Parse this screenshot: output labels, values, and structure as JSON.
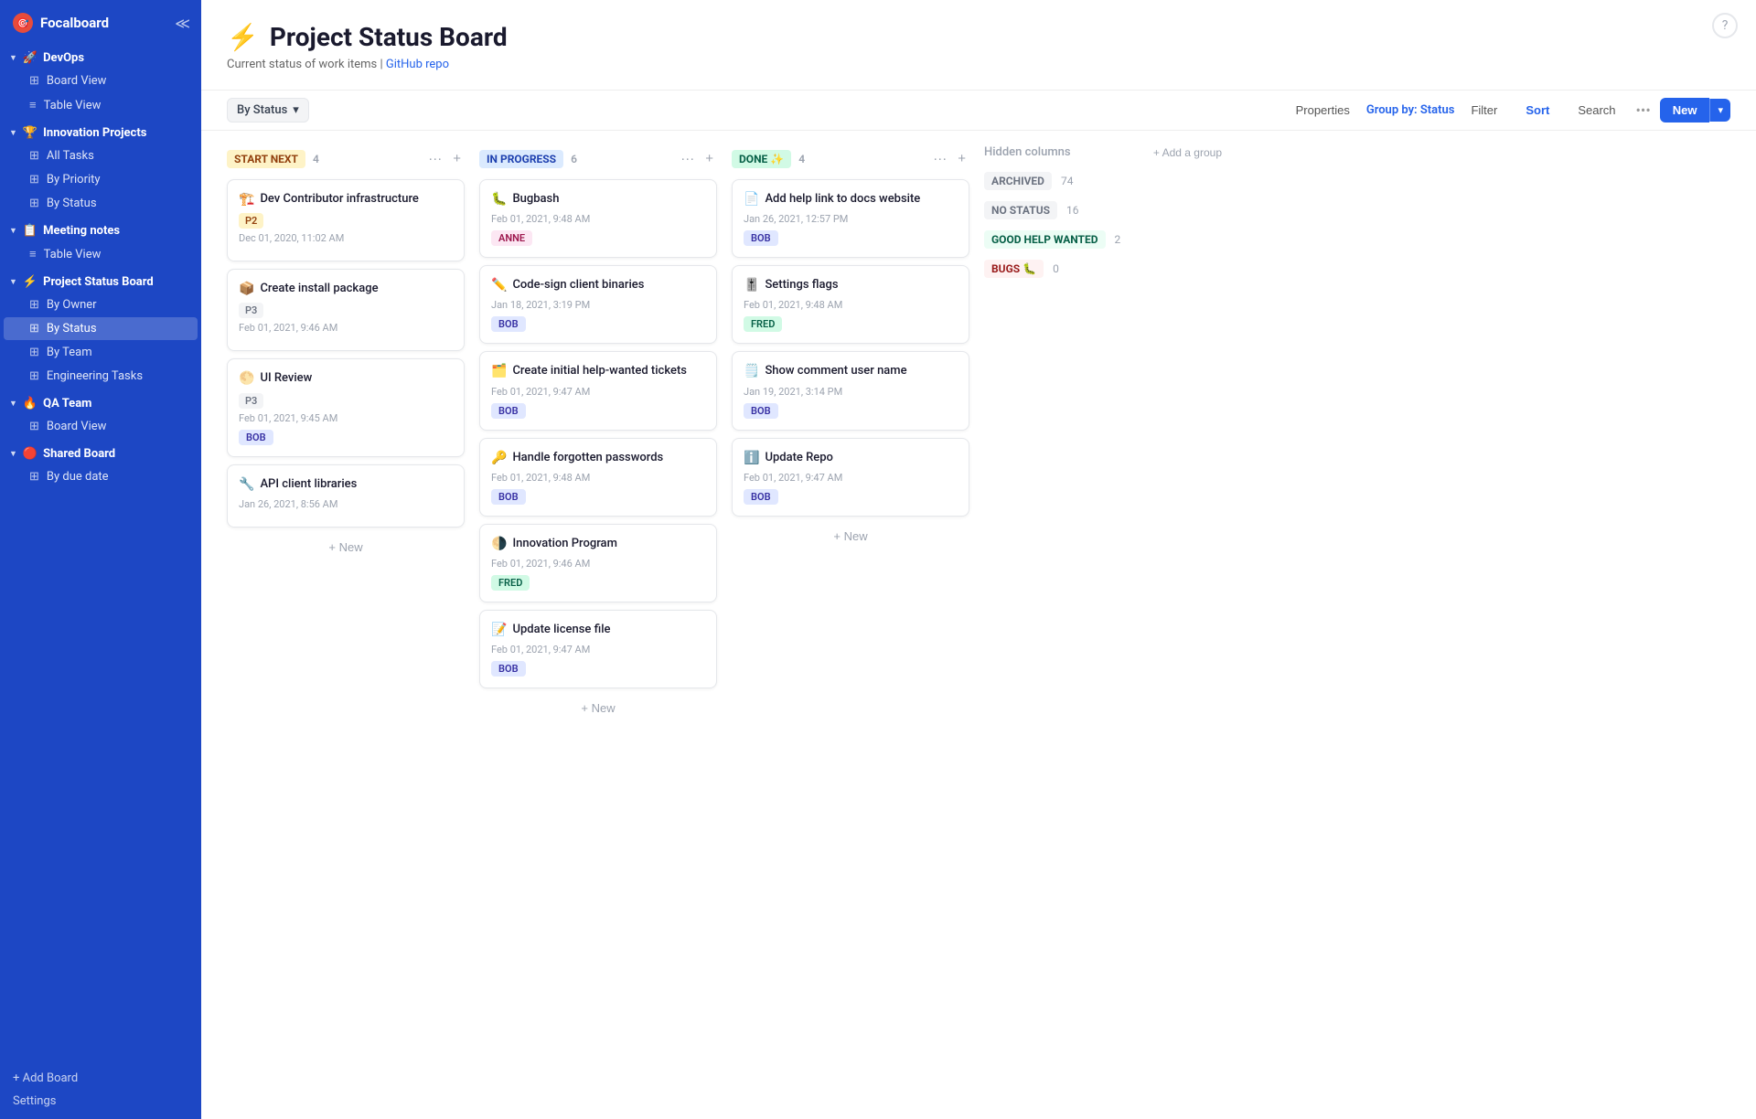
{
  "app": {
    "name": "Focalboard",
    "logo_icon": "🎯"
  },
  "sidebar": {
    "groups": [
      {
        "id": "devops",
        "emoji": "🚀",
        "label": "DevOps",
        "items": [
          {
            "id": "board-view-devops",
            "icon": "⊞",
            "label": "Board View"
          },
          {
            "id": "table-view-devops",
            "icon": "≡",
            "label": "Table View"
          }
        ]
      },
      {
        "id": "innovation",
        "emoji": "🏆",
        "label": "Innovation Projects",
        "items": [
          {
            "id": "all-tasks",
            "icon": "⊞",
            "label": "All Tasks"
          },
          {
            "id": "by-priority",
            "icon": "⊞",
            "label": "By Priority"
          },
          {
            "id": "by-status-innovation",
            "icon": "⊞",
            "label": "By Status"
          }
        ]
      },
      {
        "id": "meeting",
        "emoji": "📋",
        "label": "Meeting notes",
        "items": [
          {
            "id": "table-view-meeting",
            "icon": "≡",
            "label": "Table View"
          }
        ]
      },
      {
        "id": "project-status",
        "emoji": "⚡",
        "label": "Project Status Board",
        "items": [
          {
            "id": "by-owner",
            "icon": "⊞",
            "label": "By Owner"
          },
          {
            "id": "by-status-project",
            "icon": "⊞",
            "label": "By Status",
            "active": true
          },
          {
            "id": "by-team",
            "icon": "⊞",
            "label": "By Team"
          },
          {
            "id": "engineering-tasks",
            "icon": "⊞",
            "label": "Engineering Tasks"
          }
        ]
      },
      {
        "id": "qa-team",
        "emoji": "🔥",
        "label": "QA Team",
        "items": [
          {
            "id": "board-view-qa",
            "icon": "⊞",
            "label": "Board View"
          }
        ]
      },
      {
        "id": "shared-board",
        "emoji": "🔴",
        "label": "Shared Board",
        "items": [
          {
            "id": "by-due-date",
            "icon": "⊞",
            "label": "By due date"
          }
        ]
      }
    ],
    "add_board_label": "+ Add Board",
    "settings_label": "Settings"
  },
  "page": {
    "emoji": "⚡",
    "title": "Project Status Board",
    "subtitle": "Current status of work items | ",
    "subtitle_link": "GitHub repo",
    "view_selector_label": "By Status"
  },
  "toolbar": {
    "properties_label": "Properties",
    "group_by_label": "Group by:",
    "group_by_value": "Status",
    "filter_label": "Filter",
    "sort_label": "Sort",
    "search_label": "Search",
    "dots_label": "•••",
    "new_label": "New"
  },
  "columns": [
    {
      "id": "start-next",
      "label": "START NEXT",
      "label_class": "label-start",
      "count": 4,
      "cards": [
        {
          "id": "c1",
          "emoji": "🏗️",
          "title": "Dev Contributor infrastructure",
          "priority": "P2",
          "priority_class": "priority-p2",
          "date": "Dec 01, 2020, 11:02 AM",
          "assignee": null
        },
        {
          "id": "c2",
          "emoji": "📦",
          "title": "Create install package",
          "priority": "P3",
          "priority_class": "priority-p3",
          "date": "Feb 01, 2021, 9:46 AM",
          "assignee": null
        },
        {
          "id": "c3",
          "emoji": "🌕",
          "title": "UI Review",
          "priority": "P3",
          "priority_class": "priority-p3",
          "date": "Feb 01, 2021, 9:45 AM",
          "assignee": "BOB",
          "assignee_class": "assignee-bob"
        },
        {
          "id": "c4",
          "emoji": "🔧",
          "title": "API client libraries",
          "priority": null,
          "date": "Jan 26, 2021, 8:56 AM",
          "assignee": null
        }
      ],
      "add_new_label": "+ New"
    },
    {
      "id": "in-progress",
      "label": "IN PROGRESS",
      "label_class": "label-inprogress",
      "count": 6,
      "cards": [
        {
          "id": "c5",
          "emoji": "🐛",
          "title": "Bugbash",
          "priority": null,
          "date": "Feb 01, 2021, 9:48 AM",
          "assignee": "ANNE",
          "assignee_class": "assignee-anne"
        },
        {
          "id": "c6",
          "emoji": "✏️",
          "title": "Code-sign client binaries",
          "priority": null,
          "date": "Jan 18, 2021, 3:19 PM",
          "assignee": "BOB",
          "assignee_class": "assignee-bob"
        },
        {
          "id": "c7",
          "emoji": "🗂️",
          "title": "Create initial help-wanted tickets",
          "priority": null,
          "date": "Feb 01, 2021, 9:47 AM",
          "assignee": "BOB",
          "assignee_class": "assignee-bob"
        },
        {
          "id": "c8",
          "emoji": "🔑",
          "title": "Handle forgotten passwords",
          "priority": null,
          "date": "Feb 01, 2021, 9:48 AM",
          "assignee": "BOB",
          "assignee_class": "assignee-bob"
        },
        {
          "id": "c9",
          "emoji": "🌗",
          "title": "Innovation Program",
          "priority": null,
          "date": "Feb 01, 2021, 9:46 AM",
          "assignee": "FRED",
          "assignee_class": "assignee-fred"
        },
        {
          "id": "c10",
          "emoji": "📝",
          "title": "Update license file",
          "priority": null,
          "date": "Feb 01, 2021, 9:47 AM",
          "assignee": "BOB",
          "assignee_class": "assignee-bob"
        }
      ],
      "add_new_label": "+ New"
    },
    {
      "id": "done",
      "label": "DONE ✨",
      "label_class": "label-done",
      "count": 4,
      "cards": [
        {
          "id": "c11",
          "emoji": "📄",
          "title": "Add help link to docs website",
          "priority": null,
          "date": "Jan 26, 2021, 12:57 PM",
          "assignee": "BOB",
          "assignee_class": "assignee-bob"
        },
        {
          "id": "c12",
          "emoji": "🎚️",
          "title": "Settings flags",
          "priority": null,
          "date": "Feb 01, 2021, 9:48 AM",
          "assignee": "FRED",
          "assignee_class": "assignee-fred"
        },
        {
          "id": "c13",
          "emoji": "🗒️",
          "title": "Show comment user name",
          "priority": null,
          "date": "Jan 19, 2021, 3:14 PM",
          "assignee": "BOB",
          "assignee_class": "assignee-bob"
        },
        {
          "id": "c14",
          "emoji": "ℹ️",
          "title": "Update Repo",
          "priority": null,
          "date": "Feb 01, 2021, 9:47 AM",
          "assignee": "BOB",
          "assignee_class": "assignee-bob"
        }
      ],
      "add_new_label": "+ New"
    }
  ],
  "hidden_columns": {
    "title": "Hidden columns",
    "add_group_label": "+ Add a group",
    "items": [
      {
        "id": "archived",
        "label": "ARCHIVED",
        "label_class": "label-archived",
        "count": "74"
      },
      {
        "id": "no-status",
        "label": "NO STATUS",
        "label_class": "label-nostatus",
        "count": "16"
      },
      {
        "id": "good-help",
        "label": "GOOD HELP WANTED",
        "label_class": "label-goodhelp",
        "count": "2"
      },
      {
        "id": "bugs",
        "label": "BUGS 🐛",
        "label_class": "label-bugs",
        "count": "0"
      }
    ]
  },
  "help_icon": "?"
}
